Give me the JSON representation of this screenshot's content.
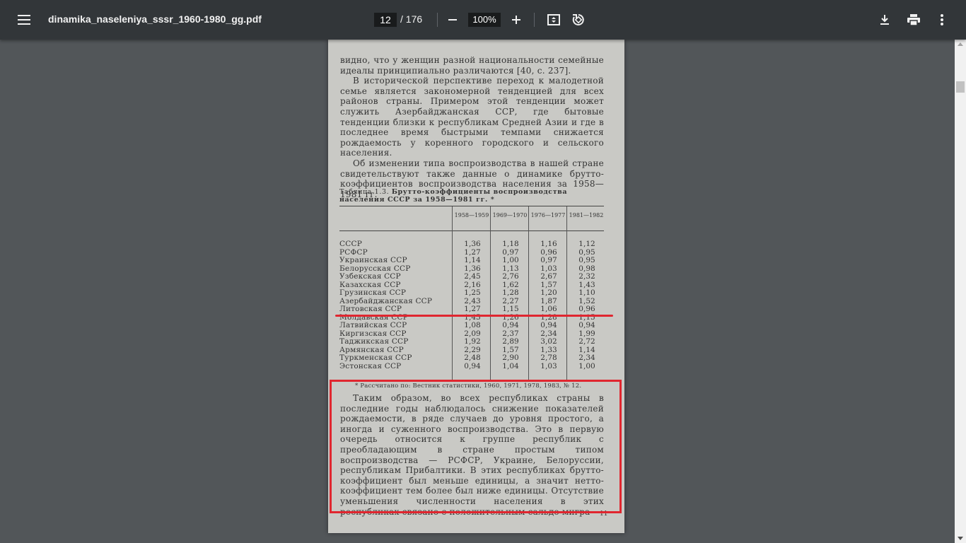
{
  "toolbar": {
    "menu_icon": "hamburger-menu-icon",
    "title": "dinamika_naseleniya_sssr_1960-1980_gg.pdf",
    "page_current": "12",
    "page_total": "/ 176",
    "zoom": "100%",
    "icons": [
      "minus-icon",
      "plus-icon",
      "fit-page-icon",
      "rotate-icon",
      "download-icon",
      "print-icon",
      "more-vert-icon"
    ]
  },
  "page": {
    "para1": "видно, что у женщин разной национальности семейные идеалы принципиально различаются [40, с. 237].",
    "para2": "В исторической перспективе переход к малодетной семье является закономерной тенденцией для всех районов страны. Примером этой тенденции может служить Азербайджанская ССР, где бытовые тенденции близки к республикам Средней Азии и где в последнее время быстрыми темпами снижается рождаемость у коренного городского и сельского населения.",
    "para3": "Об изменении типа воспроизводства в нашей стране свидетельствуют также данные о динамике брутто-коэффициентов воспроизводства населения за 1958—1981 гг.",
    "table_label": "Таблица 1.3.",
    "table_title": "Брутто-коэффициенты воспроизводства населения СССР за 1958—1981 гг. *",
    "columns": [
      "1958—1959",
      "1969—1970",
      "1976—1977",
      "1981—1982"
    ],
    "rows": [
      {
        "name": "СССР",
        "v": [
          "1,36",
          "1,18",
          "1,16",
          "1,12"
        ]
      },
      {
        "name": "РСФСР",
        "v": [
          "1,27",
          "0,97",
          "0,96",
          "0,95"
        ]
      },
      {
        "name": "Украинская ССР",
        "v": [
          "1,14",
          "1,00",
          "0,97",
          "0,95"
        ]
      },
      {
        "name": "Белорусская ССР",
        "v": [
          "1,36",
          "1,13",
          "1,03",
          "0,98"
        ]
      },
      {
        "name": "Узбекская ССР",
        "v": [
          "2,45",
          "2,76",
          "2,67",
          "2,32"
        ]
      },
      {
        "name": "Казахская ССР",
        "v": [
          "2,16",
          "1,62",
          "1,57",
          "1,43"
        ]
      },
      {
        "name": "Грузинская ССР",
        "v": [
          "1,25",
          "1,28",
          "1,20",
          "1,10"
        ]
      },
      {
        "name": "Азербайджанская ССР",
        "v": [
          "2,43",
          "2,27",
          "1,87",
          "1,52"
        ]
      },
      {
        "name": "Литовская ССР",
        "v": [
          "1,27",
          "1,15",
          "1,06",
          "0,96"
        ]
      },
      {
        "name": "Молдавская ССР",
        "v": [
          "1,45",
          "1,26",
          "1,28",
          "1,15"
        ]
      },
      {
        "name": "Латвийская ССР",
        "v": [
          "1,08",
          "0,94",
          "0,94",
          "0,94"
        ]
      },
      {
        "name": "Киргизская ССР",
        "v": [
          "2,09",
          "2,37",
          "2,34",
          "1,99"
        ]
      },
      {
        "name": "Таджикская ССР",
        "v": [
          "1,92",
          "2,89",
          "3,02",
          "2,72"
        ]
      },
      {
        "name": "Армянская ССР",
        "v": [
          "2,29",
          "1,57",
          "1,33",
          "1,14"
        ]
      },
      {
        "name": "Туркменская ССР",
        "v": [
          "2,48",
          "2,90",
          "2,78",
          "2,34"
        ]
      },
      {
        "name": "Эстонская ССР",
        "v": [
          "0,94",
          "1,04",
          "1,03",
          "1,00"
        ]
      }
    ],
    "footnote": "* Рассчитано по: Вестник статистики, 1960, 1971, 1978, 1983, № 12.",
    "para4": "Таким образом, во всех республиках страны в последние годы наблюдалось снижение показателей рождаемости, в ряде случаев до уровня простого, а иногда и суженного воспроизводства. Это в первую очередь относится к группе республик с преобладающим в стране простым типом воспроизводства — РСФСР, Украине, Белоруссии, республикам Прибалтики. В этих республиках брутто-коэффициент был меньше единицы, а значит нетто-коэффициент тем более был ниже единицы. Отсутствие уменьшения численности населения в этих республиках связано с положительным сальдо мигра-",
    "page_number": "11"
  },
  "annotations": {
    "color": "#e0262f"
  }
}
